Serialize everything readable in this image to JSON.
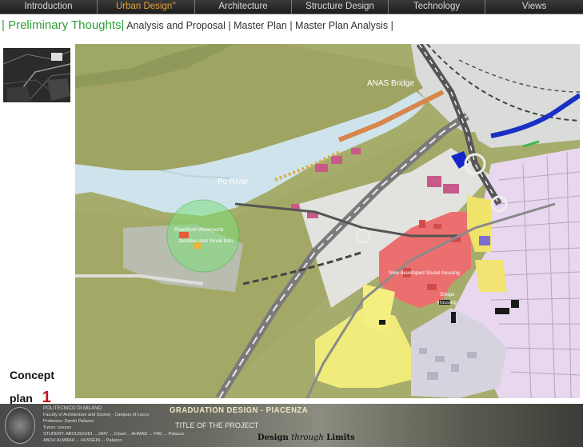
{
  "nav": {
    "tabs": [
      {
        "label": "Introduction",
        "active": false
      },
      {
        "label": "Urban Design'’",
        "active": true
      },
      {
        "label": "Architecture",
        "active": false
      },
      {
        "label": "Structure Design",
        "active": false
      },
      {
        "label": "Technology",
        "active": false
      },
      {
        "label": "Views",
        "active": false
      }
    ]
  },
  "subnav": {
    "prefix": "| Preliminary  Thoughts|",
    "links": [
      "Analysis and Proposal",
      "Master Plan",
      "Master Plan Analysis"
    ],
    "separator": "|"
  },
  "map": {
    "labels": {
      "anas": "ANAS Bridge",
      "po": "Po River",
      "waterfront_1": "Riverfront Waterports",
      "waterfront_2": "facilities and Small bars",
      "housing": "New developed Social housing",
      "shops": "Shops",
      "housing2": "Housing"
    }
  },
  "concept": {
    "word1": "Concept",
    "word2": "plan",
    "number": "1"
  },
  "footer": {
    "university": "POLITECNICO DI MILANO",
    "faculty": "Faculty of Architecture and Society - Campus of Lecco",
    "professor": "Professor: Danilo Palazzo",
    "tutor": "Tutors: xxxxxx",
    "student1": "STUDENT: ABOUSOUDI ... 2847 ... Cloud ... AHMAD ... FRE ... Palazzo",
    "student2": "ABOU ALMIRHI ... HUSSEIN ... Palazzo",
    "banner": "GRADUATION DESIGN - PIACENZA",
    "project_title": "TITLE OF THE PROJECT",
    "tagline_a": "Design",
    "tagline_b": "through",
    "tagline_c": "Limits"
  },
  "colors": {
    "accent_tab": "#e8a33a",
    "subnav_green": "#2f9e3a",
    "river": "#cfe3ec",
    "land": "#a3aa6a",
    "concept_red": "#c0161e"
  }
}
